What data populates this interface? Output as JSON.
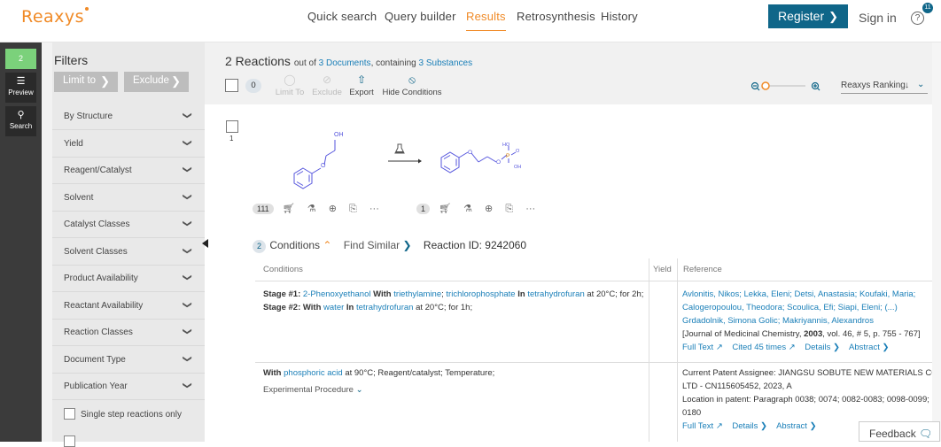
{
  "app": {
    "logo": "Reaxys"
  },
  "nav": {
    "items": [
      "Quick search",
      "Query builder",
      "Results",
      "Retrosynthesis",
      "History"
    ],
    "active": "Results"
  },
  "header_actions": {
    "register": "Register",
    "sign_in": "Sign in",
    "help": "?",
    "notif_count": "11"
  },
  "rail": {
    "badge": "2",
    "preview": "Preview",
    "search": "Search"
  },
  "filters": {
    "title": "Filters",
    "limit_to": "Limit to",
    "exclude": "Exclude",
    "items": [
      "By Structure",
      "Yield",
      "Reagent/Catalyst",
      "Solvent",
      "Catalyst Classes",
      "Solvent Classes",
      "Product Availability",
      "Reactant Availability",
      "Reaction Classes",
      "Document Type",
      "Publication Year"
    ],
    "single_step": "Single step reactions only"
  },
  "results_header": {
    "count": "2 Reactions",
    "out_of": "out of",
    "documents": "3 Documents",
    "containing": ", containing",
    "substances": "3 Substances",
    "selected_count": "0",
    "tools": {
      "limit_to": "Limit To",
      "exclude": "Exclude",
      "export": "Export",
      "hide_conditions": "Hide Conditions"
    },
    "ranking": "Reaxys Ranking"
  },
  "reaction": {
    "index": "1",
    "reactant_count": "111",
    "product_count": "1",
    "conditions_count": "2",
    "conditions_label": "Conditions",
    "find_similar": "Find Similar",
    "reaction_id": "Reaction ID: 9242060",
    "more": "···"
  },
  "table": {
    "headers": {
      "conditions": "Conditions",
      "yield": "Yield",
      "reference": "Reference"
    },
    "row1": {
      "stage1_label": "Stage #1:",
      "stage1_reagent": "2-Phenoxyethanol",
      "with": "With",
      "stage1_r2": "triethylamine",
      "stage1_sep": ";",
      "stage1_r3": "trichlorophosphate",
      "in": "In",
      "stage1_solvent": "tetrahydrofuran",
      "stage1_tail": "at 20°C; for 2h;",
      "stage2_label": "Stage #2:",
      "stage2_reagent": "water",
      "stage2_solvent": "tetrahydrofuran",
      "stage2_tail": "at 20°C; for 1h;",
      "authors_line1": "Avlonitis, Nikos; Lekka, Eleni; Detsi, Anastasia; Koufaki, Maria;",
      "authors_line2": "Calogeropoulou, Theodora; Scoulica, Efi; Siapi, Eleni; (...)",
      "authors_line3": "Grdadolnik, Simona Golic; Makriyannis, Alexandros",
      "journal_pre": "[Journal of Medicinal Chemistry,",
      "journal_year": "2003",
      "journal_post": ", vol. 46, # 5, p. 755 - 767]",
      "full_text": "Full Text",
      "cited": "Cited 45 times",
      "details": "Details",
      "abstract": "Abstract"
    },
    "row2": {
      "with": "With",
      "reagent": "phosphoric acid",
      "tail": "at 90°C; Reagent/catalyst; Temperature;",
      "exp_proc": "Experimental Procedure",
      "assignee_line1": "Current Patent Assignee: JIANGSU SOBUTE NEW MATERIALS CO",
      "assignee_line2": "LTD - CN115605452, 2023, A",
      "location_line1": "Location in patent: Paragraph 0038; 0074; 0082-0083; 0098-0099;",
      "location_line2": "0180",
      "full_text": "Full Text",
      "details": "Details",
      "abstract": "Abstract"
    }
  },
  "feedback": "Feedback",
  "colors": {
    "brand_orange": "#f08a26",
    "primary_teal": "#0f6689",
    "link": "#1a7fb8",
    "molecule": "#5555dd"
  }
}
